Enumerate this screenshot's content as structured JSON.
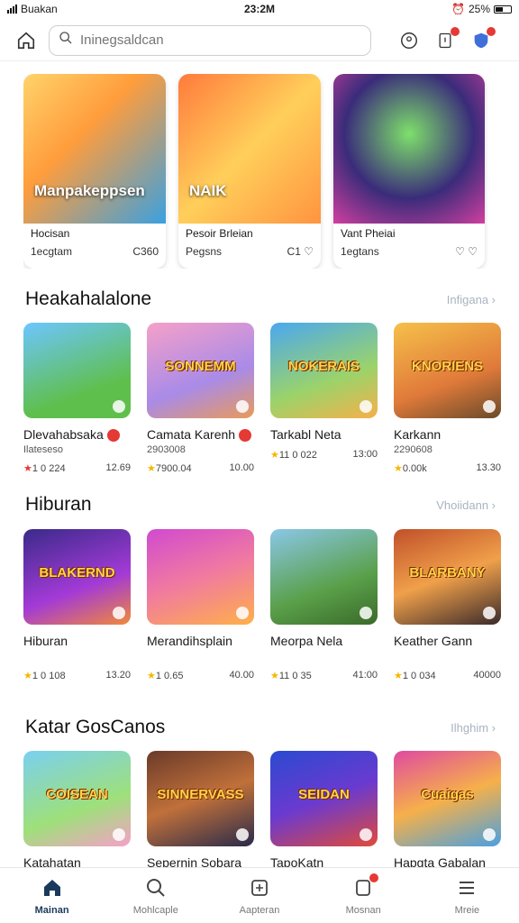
{
  "status_bar": {
    "carrier": "Buakan",
    "time": "23:2M",
    "battery": "25%"
  },
  "search": {
    "placeholder": "Ininegsaldcan"
  },
  "featured": [
    {
      "overlay": "Manpakeppsen",
      "title": "Hocisan",
      "subtitle": "1ecgtam",
      "stat": "C360"
    },
    {
      "overlay": "NAIK",
      "title": "Pesoir Brleian",
      "subtitle": "Pegsns",
      "stat": "C1"
    },
    {
      "overlay": "",
      "title": "Vant Pheiai",
      "subtitle": "1egtans",
      "stat": ""
    }
  ],
  "sections": [
    {
      "title": "Heakahalalone",
      "more": "Infigana",
      "items": [
        {
          "banner": "",
          "title": "Dlevahabsaka",
          "sub": "Ilateseso",
          "rating": "1 0 224",
          "count": "12.69",
          "red": true
        },
        {
          "banner": "SONNEMM",
          "title": "Camata Karenh",
          "sub": "2903008",
          "rating": "7900.04",
          "count": "10.00",
          "red": false
        },
        {
          "banner": "NOKERAIS",
          "title": "Tarkabl Neta",
          "sub": "",
          "rating": "11 0 022",
          "count": "13:00",
          "red": false
        },
        {
          "banner": "KNORIENS",
          "title": "Karkann",
          "sub": "2290608",
          "rating": "0.00k",
          "count": "13.30",
          "red": false
        }
      ]
    },
    {
      "title": "Hiburan",
      "more": "Vhoiidann",
      "items": [
        {
          "banner": "BLAKERND",
          "title": "Hiburan",
          "sub": "",
          "rating": "1 0 108",
          "count": "13.20",
          "red": false
        },
        {
          "banner": "",
          "title": "Merandihsplain",
          "sub": "",
          "rating": "1 0.65",
          "count": "40.00",
          "red": false
        },
        {
          "banner": "",
          "title": "Meorpa Nela",
          "sub": "",
          "rating": "11 0 35",
          "count": "41:00",
          "red": false
        },
        {
          "banner": "BLARBANY",
          "title": "Keather Gann",
          "sub": "",
          "rating": "1 0 034",
          "count": "40000",
          "red": false
        }
      ]
    },
    {
      "title": "Katar GosCanos",
      "more": "Ilhghim",
      "items": [
        {
          "banner": "COISEAN",
          "title": "Katahatan",
          "sub": "",
          "rating": "",
          "count": "",
          "red": false
        },
        {
          "banner": "SINNERVASS",
          "title": "Sepernin Sobara",
          "sub": "",
          "rating": "",
          "count": "",
          "red": false
        },
        {
          "banner": "SEIDAN",
          "title": "TapoKatn",
          "sub": "",
          "rating": "",
          "count": "",
          "red": false
        },
        {
          "banner": "Cuaigas",
          "title": "Hapgta Gabalan",
          "sub": "",
          "rating": "",
          "count": "",
          "red": false
        }
      ]
    }
  ],
  "nav": [
    {
      "label": "Mainan"
    },
    {
      "label": "Mohlcaple"
    },
    {
      "label": "Aapteran"
    },
    {
      "label": "Mosnan"
    },
    {
      "label": "Mreie"
    }
  ],
  "colors": {
    "accent": "#1a3a5c",
    "badge": "#e53935",
    "star": "#f6b800"
  }
}
